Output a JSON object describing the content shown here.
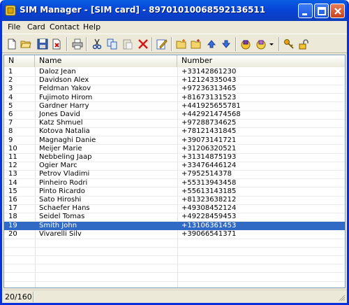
{
  "window": {
    "title": "SIM Manager - [SIM card] - 89701010068592136511"
  },
  "menu": [
    "File",
    "Card",
    "Contact",
    "Help"
  ],
  "toolbar": {
    "icons": [
      "new-file-icon",
      "open-folder-icon",
      "save-icon",
      "delete-file-icon",
      "print-icon",
      "cut-icon",
      "copy-icon",
      "paste-icon",
      "delete-icon",
      "edit-icon",
      "add-contact-icon",
      "edit-contact-icon",
      "move-up-icon",
      "move-down-icon",
      "sim-read-icon",
      "sim-write-icon",
      "dropdown-icon",
      "key-icon",
      "unlock-icon"
    ]
  },
  "list": {
    "columns": [
      "N",
      "Name",
      "Number"
    ],
    "rows": [
      [
        "1",
        "Daloz Jean",
        "+33142861230"
      ],
      [
        "2",
        "Davidson Alex",
        "+12124335043"
      ],
      [
        "3",
        "Feldman Yakov",
        "+97236313465"
      ],
      [
        "4",
        "Fujimoto Hirom",
        "+81673131523"
      ],
      [
        "5",
        "Gardner Harry",
        "+441925655781"
      ],
      [
        "6",
        "Jones David",
        "+442921474568"
      ],
      [
        "7",
        "Katz Shmuel",
        "+97288734625"
      ],
      [
        "8",
        "Kotova Natalia",
        "+78121431845"
      ],
      [
        "9",
        "Magnaghi Danie",
        "+39073141721"
      ],
      [
        "10",
        "Meijer Marie",
        "+31206320521"
      ],
      [
        "11",
        "Nebbeling Jaap",
        "+31314875193"
      ],
      [
        "12",
        "Ogier Marc",
        "+33476446124"
      ],
      [
        "13",
        "Petrov Vladimi",
        "+7952514378"
      ],
      [
        "14",
        "Pinheiro Rodri",
        "+55313943458"
      ],
      [
        "15",
        "Pinto Ricardo",
        "+55613143185"
      ],
      [
        "16",
        "Sato Hiroshi",
        "+81323638212"
      ],
      [
        "17",
        "Schaefer Hans",
        "+49308452124"
      ],
      [
        "18",
        "Seidel Tomas",
        "+49228459453"
      ],
      [
        "19",
        "Smith John",
        "+13106361453"
      ],
      [
        "20",
        "Vivarelli Silv",
        "+39066541371"
      ]
    ],
    "selected_index": 18
  },
  "status": {
    "count": "20/160"
  },
  "colors": {
    "selection": "#316ac5",
    "titlebar": "#0845d6"
  }
}
